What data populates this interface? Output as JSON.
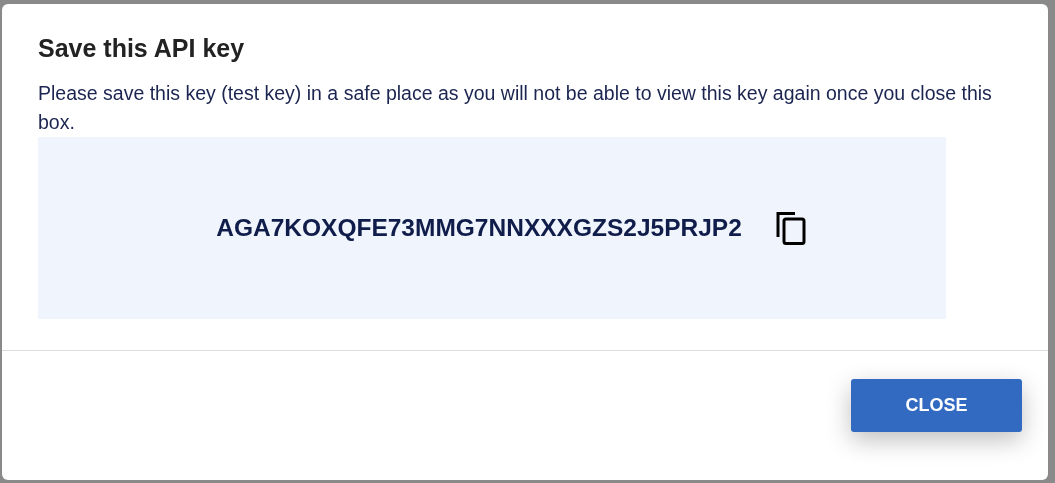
{
  "dialog": {
    "title": "Save this API key",
    "message": "Please save this key (test key) in a safe place as you will not be able to view this key again once you close this box.",
    "api_key": "AGA7KOXQFE73MMG7NNXXXGZS2J5PRJP2",
    "buttons": [
      "CLOSE"
    ]
  }
}
